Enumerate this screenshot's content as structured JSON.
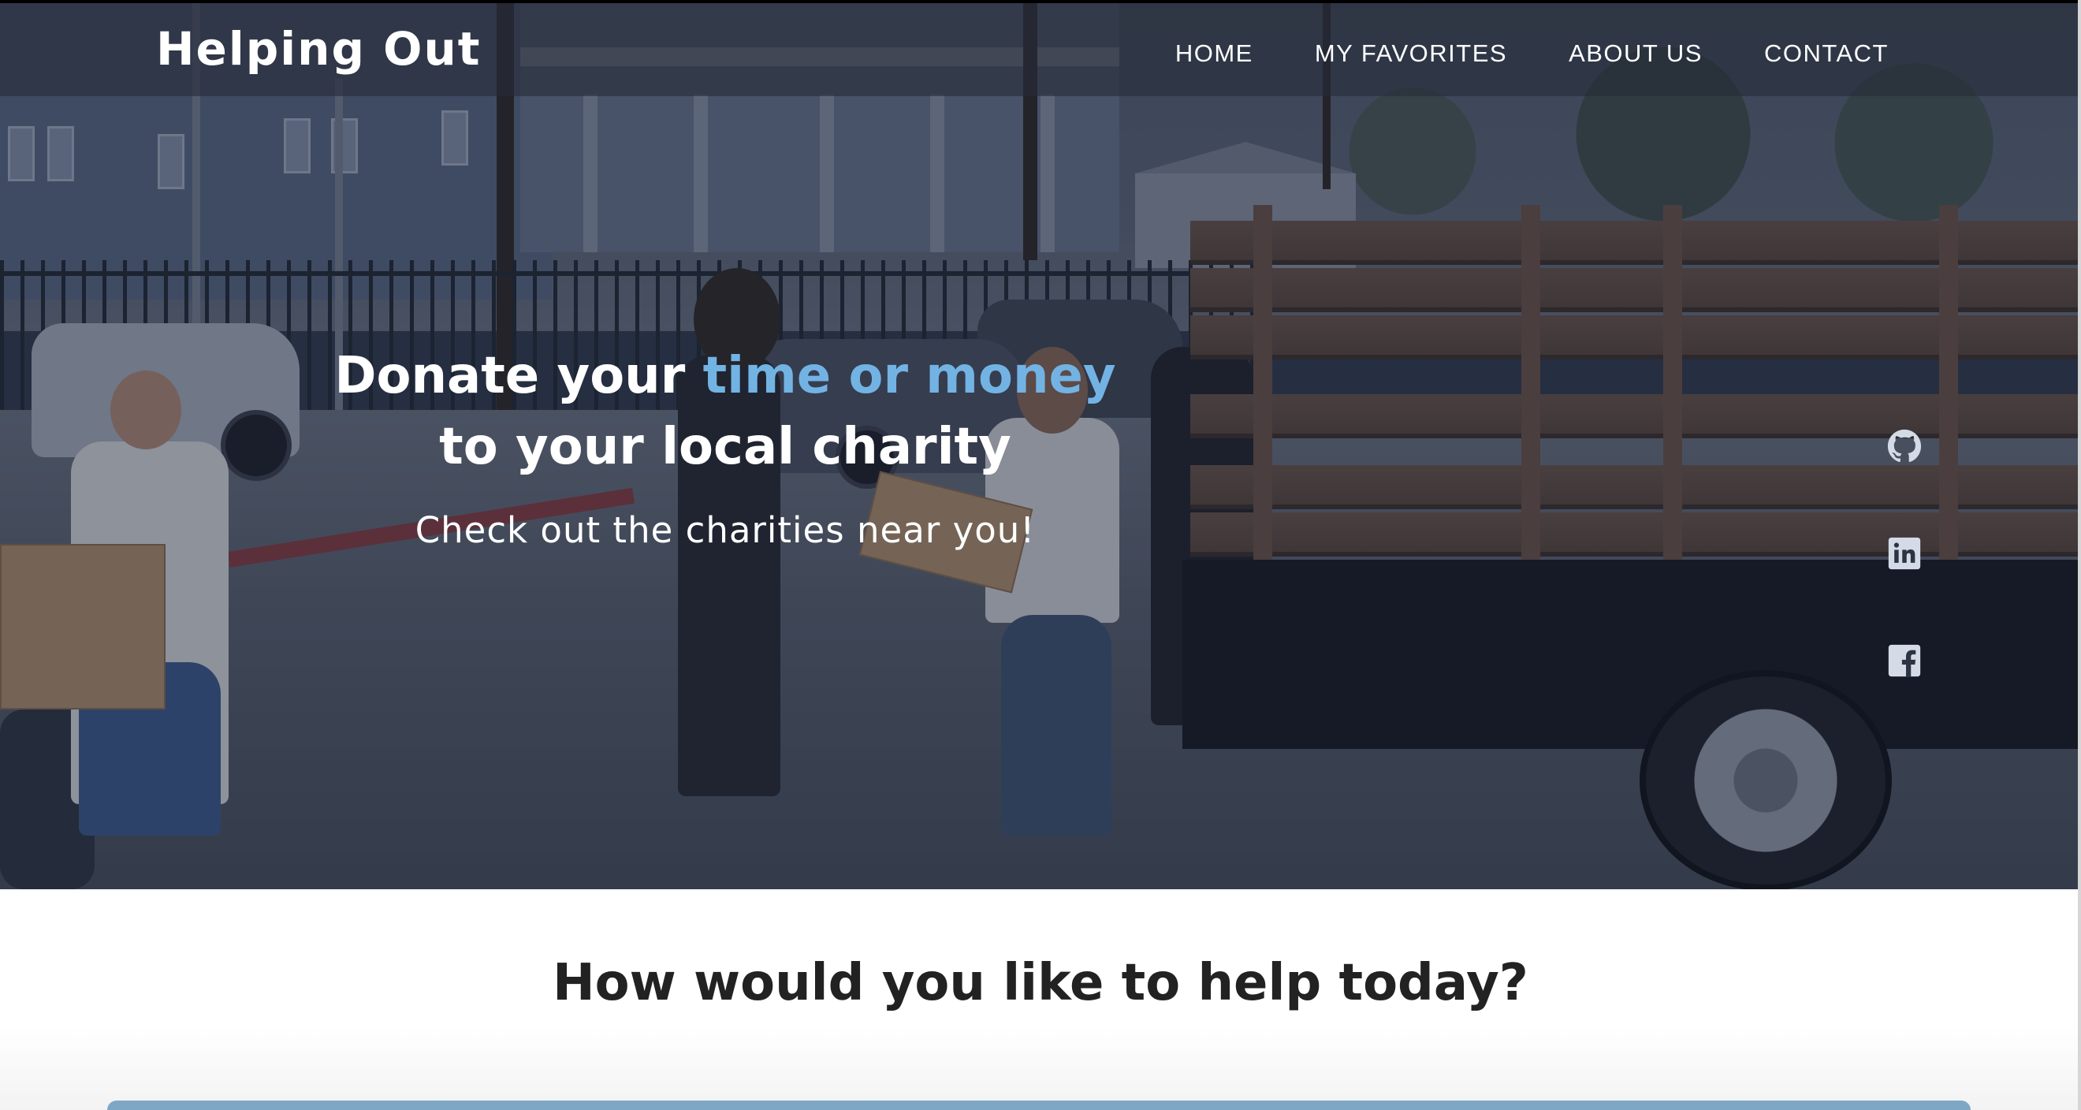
{
  "brand": {
    "name": "Helping Out"
  },
  "nav": {
    "items": [
      {
        "label": "HOME"
      },
      {
        "label": "MY FAVORITES"
      },
      {
        "label": "ABOUT US"
      },
      {
        "label": "CONTACT"
      }
    ]
  },
  "hero": {
    "headline_part1": "Donate your ",
    "headline_accent": "time or money",
    "headline_part2": "to your local charity",
    "subheading": "Check out the charities near you!",
    "accent_color": "#72b3e4"
  },
  "social": {
    "icons": [
      "github-icon",
      "linkedin-icon",
      "facebook-icon"
    ]
  },
  "section": {
    "title": "How would you like to help today?"
  }
}
